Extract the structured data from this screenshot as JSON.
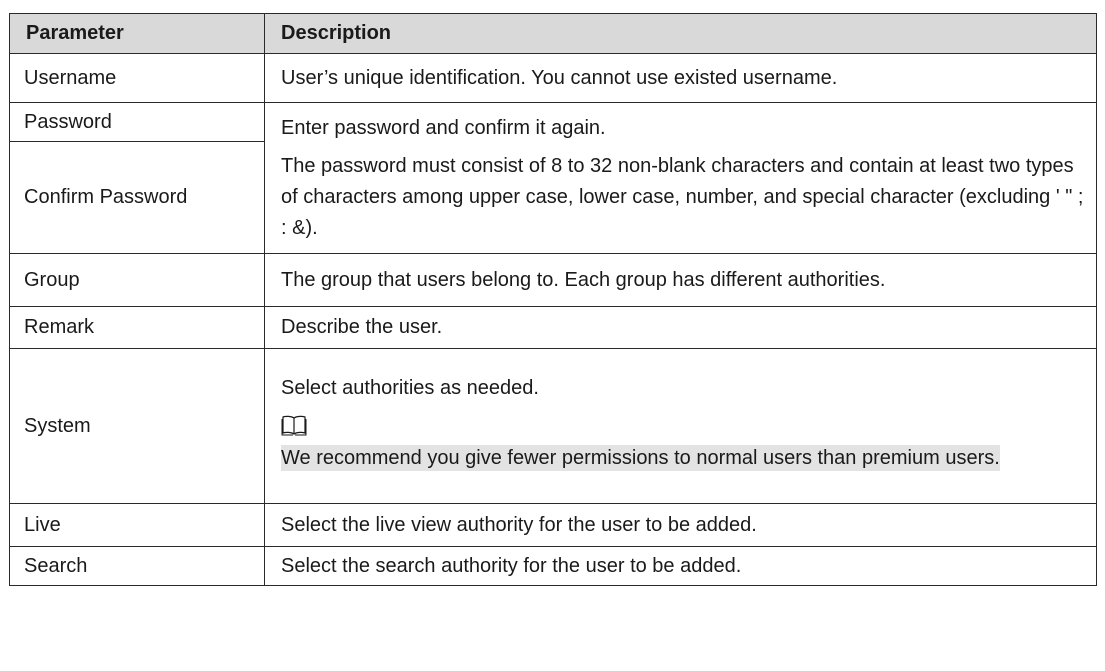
{
  "table": {
    "headers": {
      "parameter": "Parameter",
      "description": "Description"
    },
    "rows": {
      "username": {
        "param": "Username",
        "desc": "User’s unique identification. You cannot use existed username."
      },
      "password": {
        "param": "Password",
        "desc_intro": "Enter password and confirm it again.",
        "desc_rule": "The password must consist of 8 to 32 non-blank characters and contain at least two types of characters among upper case, lower case, number, and special character (excluding ' \" ; : &)."
      },
      "confirm": {
        "param": "Confirm Password"
      },
      "group": {
        "param": "Group",
        "desc": "The group that users belong to. Each group has different authorities."
      },
      "remark": {
        "param": "Remark",
        "desc": "Describe the user."
      },
      "system": {
        "param": "System",
        "desc": "Select authorities as needed.",
        "note_icon": "book-icon",
        "note": "We recommend you give fewer permissions to normal users than premium users."
      },
      "live": {
        "param": "Live",
        "desc": "Select the live view authority for the user to be added."
      },
      "search": {
        "param": "Search",
        "desc": "Select the search authority for the user to be added."
      }
    }
  }
}
